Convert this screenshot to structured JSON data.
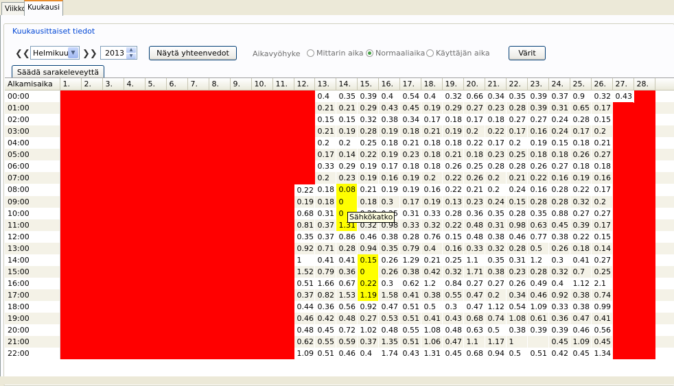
{
  "tabs": [
    {
      "label": "Viikko",
      "active": false
    },
    {
      "label": "Kuukausi",
      "active": true
    }
  ],
  "group_title": "Kuukausittaiset tiedot",
  "controls": {
    "month": "Helmikuu",
    "year": "2013",
    "show_summaries_label": "Näytä yhteenvedot",
    "timezone_label": "Aikavyöhyke",
    "radio_options": [
      {
        "label": "Mittarin aika",
        "selected": false
      },
      {
        "label": "Normaaliaika",
        "selected": true
      },
      {
        "label": "Käyttäjän aika",
        "selected": false
      }
    ],
    "colors_label": "Värit",
    "adjust_columns_label": "Säädä sarakeleveyttä"
  },
  "tooltip": "Sähkökatko",
  "colors": {
    "missing": "#ff0000",
    "outage": "#ffff00",
    "accent": "#0046d5"
  },
  "table": {
    "start_col_header": "Alkamisaika",
    "day_headers": [
      "1.",
      "2.",
      "3.",
      "4.",
      "5.",
      "6.",
      "7.",
      "8.",
      "9.",
      "10.",
      "11.",
      "12.",
      "13.",
      "14.",
      "15.",
      "16.",
      "17.",
      "18.",
      "19.",
      "20.",
      "21.",
      "22.",
      "23.",
      "24.",
      "25.",
      "26.",
      "27.",
      "28."
    ],
    "rows": [
      {
        "time": "00:00",
        "values": {
          "13": "0.4",
          "14": "0.35",
          "15": "0.39",
          "16": "0.4",
          "17": "0.54",
          "18": "0.4",
          "19": "0.32",
          "20": "0.66",
          "21": "0.34",
          "22": "0.35",
          "23": "0.39",
          "24": "0.37",
          "25": "0.9",
          "26": "0.32",
          "27": "0.43"
        }
      },
      {
        "time": "01:00",
        "values": {
          "13": "0.21",
          "14": "0.21",
          "15": "0.29",
          "16": "0.43",
          "17": "0.45",
          "18": "0.19",
          "19": "0.29",
          "20": "0.27",
          "21": "0.23",
          "22": "0.28",
          "23": "0.39",
          "24": "0.31",
          "25": "0.65",
          "26": "0.17"
        }
      },
      {
        "time": "02:00",
        "values": {
          "13": "0.15",
          "14": "0.15",
          "15": "0.32",
          "16": "0.38",
          "17": "0.34",
          "18": "0.17",
          "19": "0.18",
          "20": "0.17",
          "21": "0.18",
          "22": "0.27",
          "23": "0.27",
          "24": "0.24",
          "25": "0.28",
          "26": "0.15"
        }
      },
      {
        "time": "03:00",
        "values": {
          "13": "0.21",
          "14": "0.19",
          "15": "0.28",
          "16": "0.19",
          "17": "0.18",
          "18": "0.21",
          "19": "0.19",
          "20": "0.2",
          "21": "0.22",
          "22": "0.17",
          "23": "0.16",
          "24": "0.24",
          "25": "0.17",
          "26": "0.2"
        }
      },
      {
        "time": "04:00",
        "values": {
          "13": "0.2",
          "14": "0.2",
          "15": "0.25",
          "16": "0.18",
          "17": "0.21",
          "18": "0.18",
          "19": "0.18",
          "20": "0.22",
          "21": "0.17",
          "22": "0.2",
          "23": "0.19",
          "24": "0.15",
          "25": "0.18",
          "26": "0.21"
        }
      },
      {
        "time": "05:00",
        "values": {
          "13": "0.17",
          "14": "0.14",
          "15": "0.22",
          "16": "0.19",
          "17": "0.23",
          "18": "0.18",
          "19": "0.21",
          "20": "0.18",
          "21": "0.23",
          "22": "0.25",
          "23": "0.18",
          "24": "0.18",
          "25": "0.26",
          "26": "0.27"
        }
      },
      {
        "time": "06:00",
        "values": {
          "13": "0.33",
          "14": "0.29",
          "15": "0.19",
          "16": "0.17",
          "17": "0.18",
          "18": "0.18",
          "19": "0.26",
          "20": "0.25",
          "21": "0.28",
          "22": "0.28",
          "23": "0.26",
          "24": "0.27",
          "25": "0.18",
          "26": "0.18"
        }
      },
      {
        "time": "07:00",
        "values": {
          "13": "0.2",
          "14": "0.23",
          "15": "0.19",
          "16": "0.16",
          "17": "0.19",
          "18": "0.2",
          "19": "0.22",
          "20": "0.26",
          "21": "0.2",
          "22": "0.21",
          "23": "0.22",
          "24": "0.16",
          "25": "0.19",
          "26": "0.16"
        }
      },
      {
        "time": "08:00",
        "values": {
          "12": "0.22",
          "13": "0.18",
          "14": "0.08",
          "15": "0.21",
          "16": "0.19",
          "17": "0.19",
          "18": "0.16",
          "19": "0.22",
          "20": "0.21",
          "21": "0.2",
          "22": "0.24",
          "23": "0.16",
          "24": "0.28",
          "25": "0.22",
          "26": "0.17"
        }
      },
      {
        "time": "09:00",
        "values": {
          "12": "0.19",
          "13": "0.18",
          "14": "0",
          "15": "0.18",
          "16": "0.3",
          "17": "0.17",
          "18": "0.19",
          "19": "0.13",
          "20": "0.23",
          "21": "0.24",
          "22": "0.15",
          "23": "0.28",
          "24": "0.28",
          "25": "0.32",
          "26": "0.2"
        }
      },
      {
        "time": "10:00",
        "values": {
          "12": "0.68",
          "13": "0.31",
          "14": "0",
          "15": "0.29",
          "16": "0.25",
          "17": "0.31",
          "18": "0.33",
          "19": "0.28",
          "20": "0.36",
          "21": "0.35",
          "22": "0.28",
          "23": "0.35",
          "24": "0.88",
          "25": "0.27",
          "26": "0.27"
        }
      },
      {
        "time": "11:00",
        "values": {
          "12": "0.81",
          "13": "0.37",
          "14": "1.31",
          "15": "0.32",
          "16": "0.98",
          "17": "0.33",
          "18": "0.32",
          "19": "0.22",
          "20": "0.48",
          "21": "0.31",
          "22": "0.98",
          "23": "0.63",
          "24": "0.45",
          "25": "0.39",
          "26": "0.17"
        }
      },
      {
        "time": "12:00",
        "values": {
          "12": "0.35",
          "13": "0.37",
          "14": "0.86",
          "15": "0.46",
          "16": "0.38",
          "17": "0.28",
          "18": "0.76",
          "19": "0.15",
          "20": "0.48",
          "21": "0.38",
          "22": "0.46",
          "23": "0.77",
          "24": "0.38",
          "25": "0.22",
          "26": "0.15"
        }
      },
      {
        "time": "13:00",
        "values": {
          "12": "0.92",
          "13": "0.71",
          "14": "0.28",
          "15": "0.94",
          "16": "0.35",
          "17": "0.79",
          "18": "0.4",
          "19": "0.16",
          "20": "0.33",
          "21": "0.32",
          "22": "0.28",
          "23": "0.5",
          "24": "0.26",
          "25": "0.18",
          "26": "0.14"
        }
      },
      {
        "time": "14:00",
        "values": {
          "12": "1",
          "13": "0.41",
          "14": "0.41",
          "15": "0.15",
          "16": "0.26",
          "17": "1.29",
          "18": "0.21",
          "19": "0.25",
          "20": "1.1",
          "21": "0.35",
          "22": "0.31",
          "23": "1.2",
          "24": "0.3",
          "25": "0.41",
          "26": "0.27"
        }
      },
      {
        "time": "15:00",
        "values": {
          "12": "1.52",
          "13": "0.79",
          "14": "0.36",
          "15": "0",
          "16": "0.26",
          "17": "0.38",
          "18": "0.42",
          "19": "0.32",
          "20": "1.71",
          "21": "0.38",
          "22": "0.23",
          "23": "0.28",
          "24": "0.32",
          "25": "0.7",
          "26": "0.25"
        }
      },
      {
        "time": "16:00",
        "values": {
          "12": "0.51",
          "13": "1.66",
          "14": "0.67",
          "15": "0.22",
          "16": "0.3",
          "17": "0.62",
          "18": "1.2",
          "19": "0.84",
          "20": "0.27",
          "21": "0.27",
          "22": "0.26",
          "23": "0.49",
          "24": "0.4",
          "25": "1.12",
          "26": "2.1"
        }
      },
      {
        "time": "17:00",
        "values": {
          "12": "0.37",
          "13": "0.82",
          "14": "1.53",
          "15": "1.19",
          "16": "1.58",
          "17": "0.41",
          "18": "0.38",
          "19": "0.55",
          "20": "0.47",
          "21": "0.2",
          "22": "0.34",
          "23": "0.46",
          "24": "0.92",
          "25": "0.38",
          "26": "0.74"
        }
      },
      {
        "time": "18:00",
        "values": {
          "12": "0.44",
          "13": "0.36",
          "14": "0.56",
          "15": "0.92",
          "16": "0.47",
          "17": "0.51",
          "18": "0.5",
          "19": "0.3",
          "20": "0.47",
          "21": "1.12",
          "22": "0.54",
          "23": "1.09",
          "24": "0.33",
          "25": "0.38",
          "26": "0.99"
        }
      },
      {
        "time": "19:00",
        "values": {
          "12": "0.46",
          "13": "0.42",
          "14": "0.48",
          "15": "0.27",
          "16": "0.53",
          "17": "0.51",
          "18": "0.41",
          "19": "0.43",
          "20": "0.68",
          "21": "0.74",
          "22": "1.08",
          "23": "0.61",
          "24": "0.36",
          "25": "0.47",
          "26": "0.41"
        }
      },
      {
        "time": "20:00",
        "values": {
          "12": "0.48",
          "13": "0.45",
          "14": "0.72",
          "15": "1.02",
          "16": "0.48",
          "17": "0.55",
          "18": "1.08",
          "19": "0.48",
          "20": "0.63",
          "21": "0.5",
          "22": "0.38",
          "23": "0.39",
          "24": "0.39",
          "25": "0.46",
          "26": "0.56"
        }
      },
      {
        "time": "21:00",
        "values": {
          "12": "0.62",
          "13": "0.55",
          "14": "0.59",
          "15": "0.37",
          "16": "1.35",
          "17": "0.51",
          "18": "1.06",
          "19": "0.47",
          "20": "1.1",
          "21": "1.17",
          "22": "1",
          "23": "",
          "24": "0.45",
          "25": "1.09",
          "26": "0.45",
          "27x": ""
        }
      },
      {
        "time": "22:00",
        "values": {
          "12": "1.09",
          "13": "0.51",
          "14": "0.46",
          "15": "0.4",
          "16": "1.74",
          "17": "0.43",
          "18": "1.31",
          "19": "0.45",
          "20": "0.68",
          "21": "0.94",
          "22": "0.5",
          "23": "0.51",
          "24": "0.42",
          "25": "0.45",
          "26": "1.34"
        }
      }
    ]
  }
}
